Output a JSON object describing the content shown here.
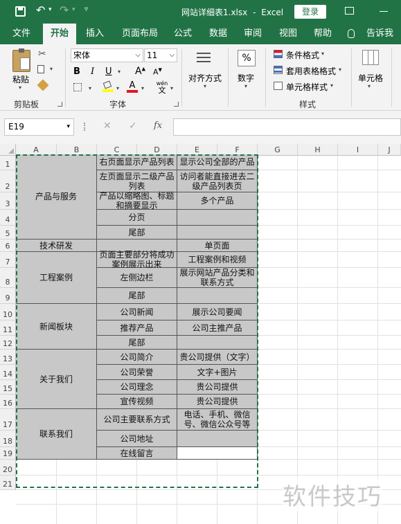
{
  "titlebar": {
    "filename": "网站详细表1.xlsx",
    "separator": "-",
    "app": "Excel",
    "login": "登录"
  },
  "tabs": [
    "文件",
    "开始",
    "插入",
    "页面布局",
    "公式",
    "数据",
    "审阅",
    "视图",
    "帮助",
    "告诉我"
  ],
  "ribbon": {
    "paste": "粘贴",
    "clipboard": "剪贴板",
    "font_name": "宋体",
    "font_size": "11",
    "bold": "B",
    "italic": "I",
    "underline": "U",
    "font_group": "字体",
    "increase_font": "A",
    "decrease_font": "A",
    "wen": "wén",
    "wen_char": "文",
    "align": "对齐方式",
    "number": "数字",
    "percent": "%",
    "cond_format": "条件格式",
    "table_format": "套用表格格式",
    "cell_style": "单元格样式",
    "style_group": "样式",
    "cells": "单元格"
  },
  "formula_bar": {
    "name_box": "E19",
    "fx": "fx",
    "value": ""
  },
  "columns": [
    "A",
    "B",
    "C",
    "D",
    "E",
    "F",
    "G",
    "H",
    "I",
    "J"
  ],
  "rows": [
    "1",
    "2",
    "3",
    "4",
    "5",
    "6",
    "7",
    "8",
    "9",
    "10",
    "11",
    "12",
    "13",
    "14",
    "15",
    "16",
    "17",
    "18",
    "19",
    "20",
    "21"
  ],
  "table": {
    "groups": [
      "产品与服务",
      "技术研发",
      "工程案例",
      "新闻板块",
      "关于我们",
      "联系我们"
    ],
    "cd": [
      "右页面显示产品列表",
      "左页面显示二级产品列表",
      "产品以缩略图、标题和摘要显示",
      "分页",
      "尾部",
      "",
      "页面主要部分将成功案例展示出来",
      "左侧边栏",
      "尾部",
      "公司新闻",
      "推荐产品",
      "尾部",
      "公司简介",
      "公司荣誉",
      "公司理念",
      "宣传视频",
      "公司主要联系方式",
      "公司地址",
      "在线留言"
    ],
    "ef": [
      "显示公司全部的产品",
      "访问者能直接进去二级产品列表页",
      "多个产品",
      "",
      "",
      "单页面",
      "工程案例和视频",
      "展示网站产品分类和联系方式",
      "",
      "展示公司要闻",
      "公司主推产品",
      "",
      "贵公司提供（文字）",
      "文字+图片",
      "贵公司提供",
      "贵公司提供",
      "电话、手机、微信号、微信公众号等",
      "",
      ""
    ]
  },
  "watermark": "软件技巧",
  "colors": {
    "excel_green": "#217346",
    "cell_fill": "#c8c8c8",
    "marquee": "#217346"
  }
}
